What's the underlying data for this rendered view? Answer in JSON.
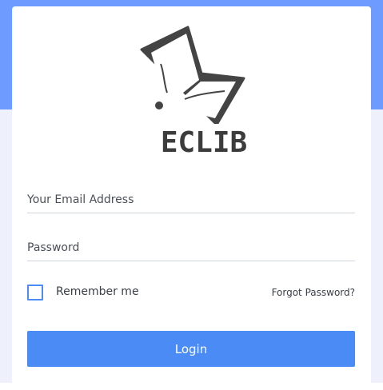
{
  "logo": {
    "icon": "open-book-icon",
    "text": "ECLIB"
  },
  "form": {
    "email_placeholder": "Your Email Address",
    "password_placeholder": "Password",
    "remember_label": "Remember me",
    "forgot_label": "Forgot Password?",
    "login_label": "Login"
  },
  "colors": {
    "header_blue": "#6e9bff",
    "button_blue": "#4b8bf5",
    "checkbox_blue": "#4d8bf8",
    "background": "#eef1fb"
  }
}
